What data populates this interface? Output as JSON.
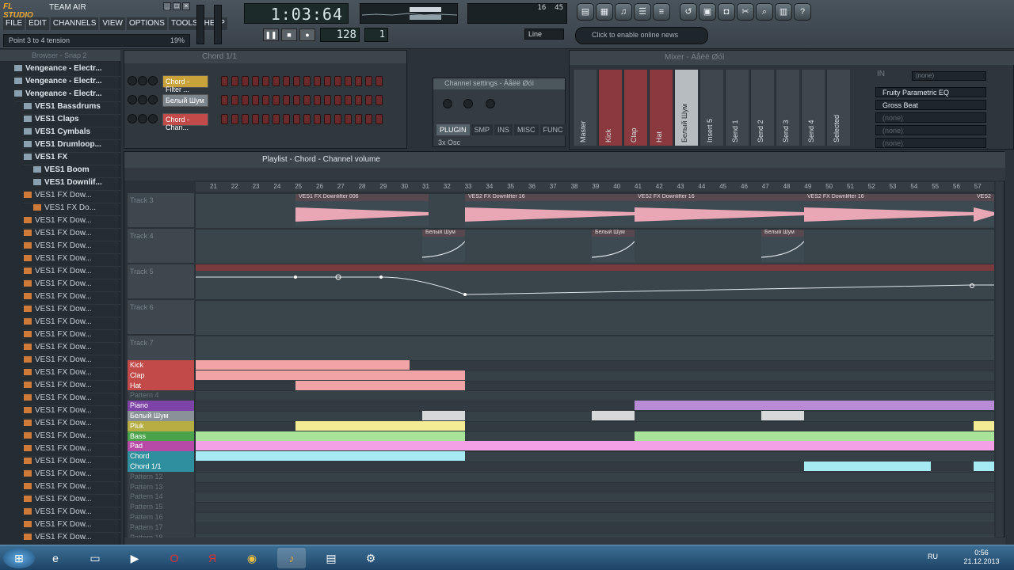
{
  "app": {
    "logo": "FL STUDIO",
    "project": "TEAM AIR"
  },
  "menu": [
    "FILE",
    "EDIT",
    "CHANNELS",
    "VIEW",
    "OPTIONS",
    "TOOLS",
    "HELP"
  ],
  "hint": {
    "text": "Point 3 to 4 tension",
    "value": "19%"
  },
  "time": "1:03:64",
  "tempo": "128",
  "pattern": "1",
  "cpu": {
    "a": "16",
    "b": "45"
  },
  "line_select": "Line",
  "news": "Click to enable online news",
  "browser": {
    "title": "Browser - Snap 2",
    "items": [
      {
        "label": "Vengeance - Electr...",
        "type": "folder",
        "indent": 1
      },
      {
        "label": "Vengeance - Electr...",
        "type": "folder",
        "indent": 1
      },
      {
        "label": "Vengeance - Electr...",
        "type": "folder",
        "indent": 1
      },
      {
        "label": "VES1 Bassdrums",
        "type": "folder",
        "indent": 2
      },
      {
        "label": "VES1 Claps",
        "type": "folder",
        "indent": 2
      },
      {
        "label": "VES1 Cymbals",
        "type": "folder",
        "indent": 2
      },
      {
        "label": "VES1 Drumloop...",
        "type": "folder",
        "indent": 2
      },
      {
        "label": "VES1 FX",
        "type": "folder",
        "indent": 2
      },
      {
        "label": "VES1 Boom",
        "type": "folder",
        "indent": 3
      },
      {
        "label": "VES1 Downlif...",
        "type": "folder",
        "indent": 3
      },
      {
        "label": "VES1 FX Dow...",
        "type": "file",
        "indent": 2
      },
      {
        "label": "VES1 FX Do...",
        "type": "file",
        "indent": 3
      },
      {
        "label": "VES1 FX Dow...",
        "type": "file",
        "indent": 2
      },
      {
        "label": "VES1 FX Dow...",
        "type": "file",
        "indent": 2
      },
      {
        "label": "VES1 FX Dow...",
        "type": "file",
        "indent": 2
      },
      {
        "label": "VES1 FX Dow...",
        "type": "file",
        "indent": 2
      },
      {
        "label": "VES1 FX Dow...",
        "type": "file",
        "indent": 2
      },
      {
        "label": "VES1 FX Dow...",
        "type": "file",
        "indent": 2
      },
      {
        "label": "VES1 FX Dow...",
        "type": "file",
        "indent": 2
      },
      {
        "label": "VES1 FX Dow...",
        "type": "file",
        "indent": 2
      },
      {
        "label": "VES1 FX Dow...",
        "type": "file",
        "indent": 2
      },
      {
        "label": "VES1 FX Dow...",
        "type": "file",
        "indent": 2
      },
      {
        "label": "VES1 FX Dow...",
        "type": "file",
        "indent": 2
      },
      {
        "label": "VES1 FX Dow...",
        "type": "file",
        "indent": 2
      },
      {
        "label": "VES1 FX Dow...",
        "type": "file",
        "indent": 2
      },
      {
        "label": "VES1 FX Dow...",
        "type": "file",
        "indent": 2
      },
      {
        "label": "VES1 FX Dow...",
        "type": "file",
        "indent": 2
      },
      {
        "label": "VES1 FX Dow...",
        "type": "file",
        "indent": 2
      },
      {
        "label": "VES1 FX Dow...",
        "type": "file",
        "indent": 2
      },
      {
        "label": "VES1 FX Dow...",
        "type": "file",
        "indent": 2
      },
      {
        "label": "VES1 FX Dow...",
        "type": "file",
        "indent": 2
      },
      {
        "label": "VES1 FX Dow...",
        "type": "file",
        "indent": 2
      },
      {
        "label": "VES1 FX Dow...",
        "type": "file",
        "indent": 2
      },
      {
        "label": "VES1 FX Dow...",
        "type": "file",
        "indent": 2
      },
      {
        "label": "VES1 FX Dow...",
        "type": "file",
        "indent": 2
      },
      {
        "label": "VES1 FX Dow...",
        "type": "file",
        "indent": 2
      },
      {
        "label": "VES1 FX Dow...",
        "type": "file",
        "indent": 2
      },
      {
        "label": "VES1 FX Dow...",
        "type": "file",
        "indent": 2
      }
    ]
  },
  "steps": {
    "title": "Chord 1/1",
    "channels": [
      {
        "name": "Chord - Filter ...",
        "color": "#c9a23a",
        "light": false
      },
      {
        "name": "Белый Шум",
        "color": "#7d868c",
        "light": true
      },
      {
        "name": "Chord - Chan...",
        "color": "#c24a48",
        "light": false
      }
    ]
  },
  "channel_settings": {
    "title": "Channel settings - Àåëë Øóì",
    "tabs": [
      "PLUGIN",
      "SMP",
      "INS",
      "MISC",
      "FUNC"
    ],
    "footer": "3x Osc"
  },
  "mixer": {
    "title": "Mixer - Àåëë Øóì",
    "strips": [
      {
        "name": "Master",
        "style": "normal"
      },
      {
        "name": "Kick",
        "style": "red"
      },
      {
        "name": "Clap",
        "style": "red"
      },
      {
        "name": "Hat",
        "style": "red"
      },
      {
        "name": "Белый Шум",
        "style": "hi"
      },
      {
        "name": "Insert 5",
        "style": "normal"
      },
      {
        "name": "Send 1",
        "style": "normal"
      },
      {
        "name": "Send 2",
        "style": "normal"
      },
      {
        "name": "Send 3",
        "style": "normal"
      },
      {
        "name": "Send 4",
        "style": "normal"
      },
      {
        "name": "Selected",
        "style": "normal"
      }
    ],
    "fx": [
      "Fruity Parametric EQ",
      "Gross Beat",
      "(none)",
      "(none)",
      "(none)"
    ],
    "preset": "(none)",
    "in": "IN"
  },
  "playlist": {
    "title": "Playlist - Chord - Channel volume",
    "ruler": [
      "21",
      "22",
      "23",
      "24",
      "25",
      "26",
      "27",
      "28",
      "29",
      "30",
      "31",
      "32",
      "33",
      "34",
      "35",
      "36",
      "37",
      "38",
      "39",
      "40",
      "41",
      "42",
      "43",
      "44",
      "45",
      "46",
      "47",
      "48",
      "49",
      "50",
      "51",
      "52",
      "53",
      "54",
      "55",
      "56",
      "57"
    ],
    "tracks": [
      "Track 3",
      "Track 4",
      "Track 5",
      "Track 6",
      "Track 7"
    ],
    "clips": {
      "downlifter_a": "VES1 FX Downlifter 006",
      "downlifter_b": "VES2 FX Downlifter 16",
      "downlifter_c": "VES2 FX Downlifter 16",
      "downlifter_d": "VES2 FX Downlifter 16",
      "downlifter_e": "VES2",
      "noise": "Белый Шум"
    },
    "patterns": [
      {
        "name": "Kick",
        "color": "#c24a48",
        "active": true
      },
      {
        "name": "Clap",
        "color": "#c24a48",
        "active": true
      },
      {
        "name": "Hat",
        "color": "#c24a48",
        "active": true
      },
      {
        "name": "Pattern 4",
        "color": "#3e474e",
        "active": false
      },
      {
        "name": "Piano",
        "color": "#7d43a6",
        "active": true
      },
      {
        "name": "Белый Шум",
        "color": "#8a9197",
        "active": true
      },
      {
        "name": "Pluk",
        "color": "#b7ae43",
        "active": true
      },
      {
        "name": "Bass",
        "color": "#4aa34a",
        "active": true
      },
      {
        "name": "Pad",
        "color": "#b64aa6",
        "active": true
      },
      {
        "name": "Chord",
        "color": "#2f8f9e",
        "active": true
      },
      {
        "name": "Chord 1/1",
        "color": "#2f8f9e",
        "active": true
      },
      {
        "name": "Pattern 12",
        "color": "#3e474e",
        "active": false
      },
      {
        "name": "Pattern 13",
        "color": "#3e474e",
        "active": false
      },
      {
        "name": "Pattern 14",
        "color": "#3e474e",
        "active": false
      },
      {
        "name": "Pattern 15",
        "color": "#3e474e",
        "active": false
      },
      {
        "name": "Pattern 16",
        "color": "#3e474e",
        "active": false
      },
      {
        "name": "Pattern 17",
        "color": "#3e474e",
        "active": false
      },
      {
        "name": "Pattern 18",
        "color": "#3e474e",
        "active": false
      }
    ]
  },
  "taskbar": {
    "lang": "RU",
    "time": "0:56",
    "date": "21.12.2013"
  }
}
